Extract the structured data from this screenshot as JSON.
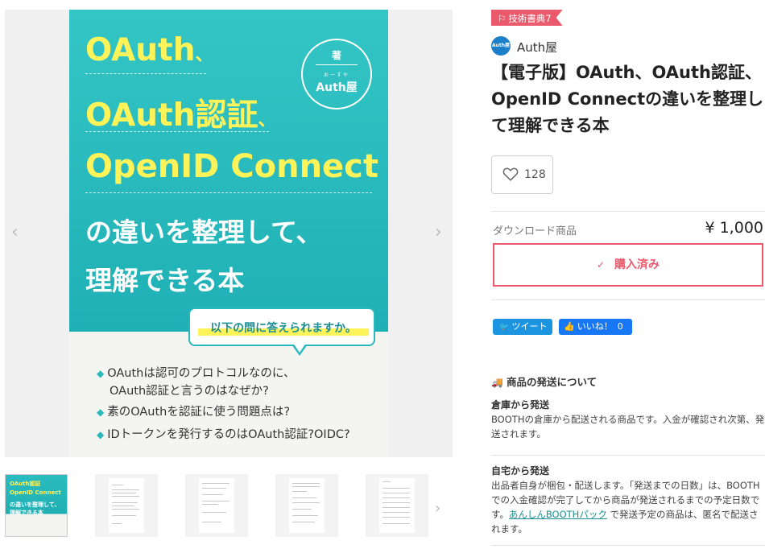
{
  "gallery": {
    "prev_arrow": "‹",
    "next_arrow": "›",
    "cover": {
      "line1": "OAuth",
      "line1_tail": "、",
      "line2": "OAuth認証",
      "line2_tail": "、",
      "line3": "OpenID Connect",
      "line4": "の違いを整理して、",
      "line5": "理解できる本",
      "badge_label": "著",
      "badge_ruby": "おーすや",
      "badge_name": "Auth屋",
      "bubble": "以下の問に答えられますか。",
      "questions": [
        "OAuthは認可のプロトコルなのに、",
        "OAuth認証と言うのはなぜか?",
        "素のOAuthを認証に使う問題点は?",
        "IDトークンを発行するのはOAuth認証?OIDC?"
      ],
      "bullet": "◆"
    },
    "thumbs": {
      "mini_line1": "OAuth認証",
      "mini_line2": "OpenID Connect",
      "mini_line3": "の違いを整理して、",
      "mini_line4": "理解できる本",
      "next_arrow": "›"
    }
  },
  "product": {
    "event_tag": "技術書典7",
    "event_tag_icon": "flag-icon",
    "shop_name": "Auth屋",
    "shop_avatar_text": "Auth屋",
    "title": "【電子版】OAuth、OAuth認証、OpenID Connectの違いを整理して理解できる本",
    "like_count": "128",
    "download_label": "ダウンロード商品",
    "price": "¥ 1,000",
    "purchased_label": "購入済み",
    "purchased_check": "✓",
    "tweet_label": "ツイート",
    "fb_like_label": "いいね！",
    "fb_like_count": "0"
  },
  "shipping": {
    "heading": "商品の発送について",
    "warehouse_title": "倉庫から発送",
    "warehouse_text": "BOOTHの倉庫から配送される商品です。入金が確認され次第、発送されます。",
    "home_title": "自宅から発送",
    "home_text_1": "出品者自身が梱包・配送します。「発送までの日数」は、BOOTHでの入金確認が完了してから商品が発送されるまでの予定日数です。",
    "home_link": "あんしんBOOTHパック",
    "home_text_2": " で発送予定の商品は、匿名で配送されます。"
  },
  "colors": {
    "accent": "#ea5a6c",
    "cover_teal": "#29b8bc",
    "cover_yellow": "#fff35a",
    "twitter": "#1b95e0",
    "facebook": "#1877f2"
  }
}
